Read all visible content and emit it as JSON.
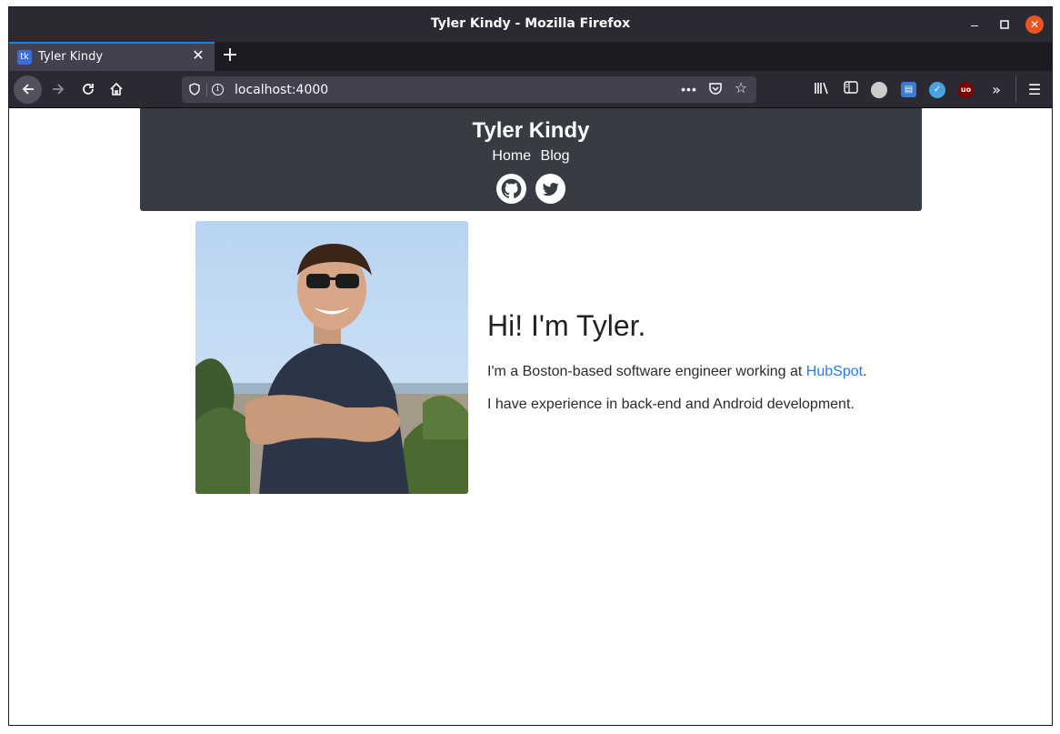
{
  "window": {
    "title": "Tyler Kindy - Mozilla Firefox"
  },
  "tabs": [
    {
      "favicon_text": "tk",
      "title": "Tyler Kindy"
    }
  ],
  "urlbar": {
    "url": "localhost:4000"
  },
  "toolbar": {
    "ext3_label": "uo"
  },
  "site": {
    "title": "Tyler Kindy",
    "nav": [
      "Home",
      "Blog"
    ],
    "social": [
      "github-icon",
      "twitter-icon"
    ]
  },
  "intro": {
    "heading": "Hi! I'm Tyler.",
    "line1_prefix": "I'm a Boston-based software engineer working at ",
    "line1_link": "HubSpot",
    "line1_suffix": ".",
    "line2": "I have experience in back-end and Android development."
  },
  "colors": {
    "header_bg": "#373c44",
    "link": "#2a7ae2",
    "firefox_dark": "#2b2a33",
    "tab_accent": "#0a84ff"
  }
}
